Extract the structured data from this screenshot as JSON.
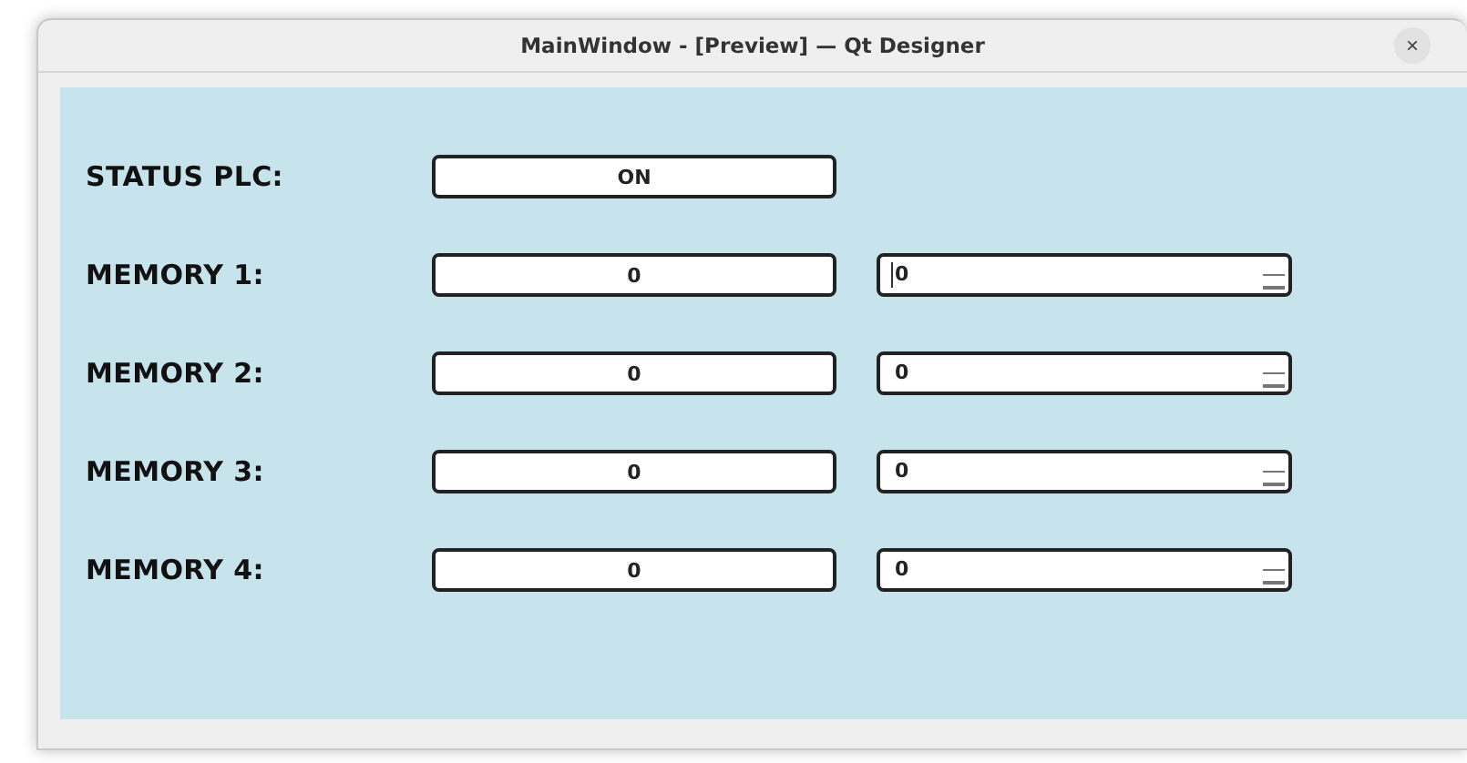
{
  "window": {
    "title": "MainWindow - [Preview] — Qt Designer",
    "close": "×"
  },
  "status": {
    "label": "STATUS PLC:",
    "value": "ON"
  },
  "memories": [
    {
      "label": "MEMORY 1:",
      "value": "0",
      "spin_value": "0",
      "focused": true
    },
    {
      "label": "MEMORY 2:",
      "value": "0",
      "spin_value": "0",
      "focused": false
    },
    {
      "label": "MEMORY 3:",
      "value": "0",
      "spin_value": "0",
      "focused": false
    },
    {
      "label": "MEMORY 4:",
      "value": "0",
      "spin_value": "0",
      "focused": false
    }
  ]
}
